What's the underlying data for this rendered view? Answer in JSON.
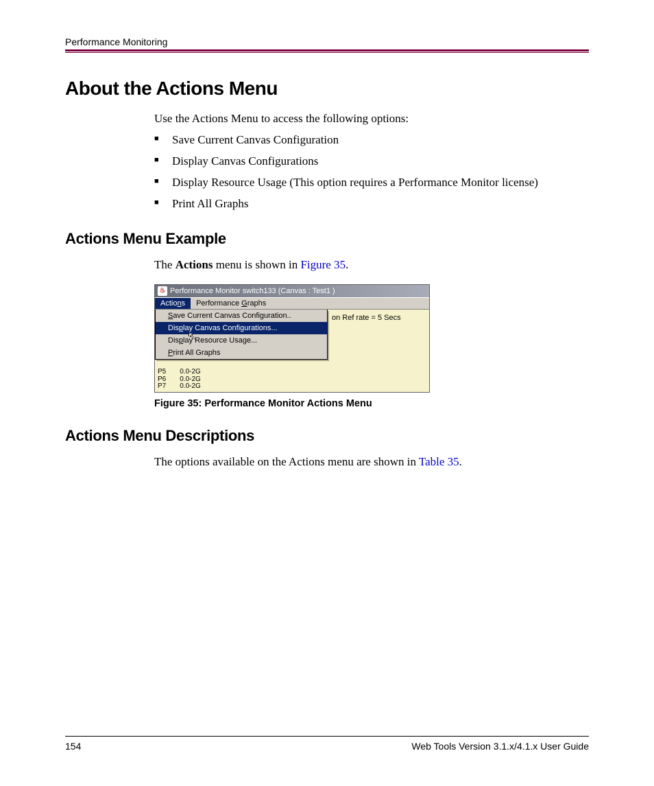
{
  "header": {
    "running": "Performance Monitoring"
  },
  "h1": "About the Actions Menu",
  "intro": "Use the Actions Menu to access the following options:",
  "bullets": [
    "Save Current Canvas Configuration",
    "Display Canvas Configurations",
    "Display Resource Usage (This option requires a Performance Monitor license)",
    "Print All Graphs"
  ],
  "example": {
    "heading": "Actions Menu Example",
    "text_before": "The ",
    "bold": "Actions",
    "text_mid": " menu is shown in ",
    "xref": "Figure 35",
    "text_after": "."
  },
  "screenshot": {
    "title": "Performance Monitor switch133 (Canvas : Test1 )",
    "menubar": {
      "actions_pre": "Actio",
      "actions_ul": "n",
      "actions_post": "s",
      "graphs_pre": "Performance ",
      "graphs_ul": "G",
      "graphs_post": "raphs"
    },
    "dropdown": {
      "i1_ul": "S",
      "i1_post": "ave Current Canvas Configuration..",
      "i2_pre": "Dis",
      "i2_ul": "p",
      "i2_post": "lay Canvas Configurations...",
      "i3_pre": "Dis",
      "i3_ul": "p",
      "i3_post": "lay Resource Usage...",
      "i4_ul": "P",
      "i4_post": "rint All Graphs"
    },
    "refrate": "on Ref rate = 5 Secs",
    "ports": [
      {
        "p": "P5",
        "v": "0.0-2G"
      },
      {
        "p": "P6",
        "v": "0.0-2G"
      },
      {
        "p": "P7",
        "v": "0.0-2G"
      }
    ],
    "caption": "Figure 35:  Performance Monitor Actions Menu"
  },
  "descriptions": {
    "heading": "Actions Menu Descriptions",
    "text_before": "The options available on the Actions menu are shown in ",
    "xref": "Table 35",
    "text_after": "."
  },
  "footer": {
    "page": "154",
    "doc": "Web Tools Version 3.1.x/4.1.x User Guide"
  }
}
